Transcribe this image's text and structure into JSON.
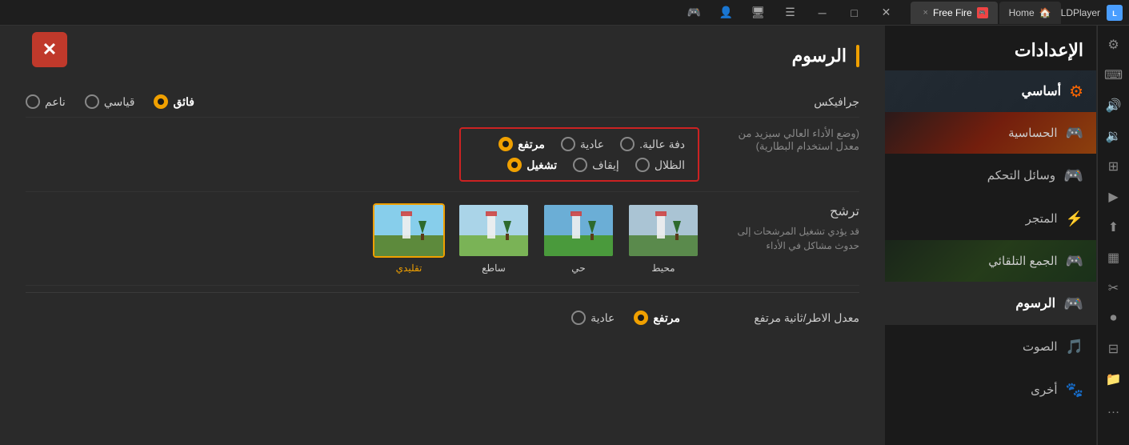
{
  "titlebar": {
    "app_name": "LDPlayer",
    "home_tab": "Home",
    "active_tab": "Free Fire",
    "close_label": "×"
  },
  "nav": {
    "title": "الإعدادات",
    "items": [
      {
        "id": "basic",
        "label": "أساسي",
        "icon": "⚙"
      },
      {
        "id": "sensitivity",
        "label": "الحساسية",
        "icon": "🎮"
      },
      {
        "id": "controls",
        "label": "وسائل التحكم",
        "icon": "🎮"
      },
      {
        "id": "store",
        "label": "المتجر",
        "icon": "🏪"
      },
      {
        "id": "auto",
        "label": "الجمع التلقائي",
        "icon": "🎮"
      },
      {
        "id": "graphics",
        "label": "الرسوم",
        "icon": "🎮",
        "active": true
      },
      {
        "id": "sound",
        "label": "الصوت",
        "icon": "🎵"
      },
      {
        "id": "other",
        "label": "أخرى",
        "icon": "🐾"
      }
    ]
  },
  "content": {
    "section_title": "الرسوم",
    "graphics_label": "جرافيكس",
    "graphics_options": [
      {
        "id": "smooth",
        "label": "ناعم",
        "selected": false
      },
      {
        "id": "standard",
        "label": "قياسي",
        "selected": false
      },
      {
        "id": "ultra",
        "label": "فائق",
        "selected": true
      }
    ],
    "perf_note_1": "(وضع الأداء العالي سيزيد من",
    "perf_note_2": "معدل استخدام البطارية)",
    "perf_options": [
      {
        "id": "high_def",
        "label": "دفة عالية.",
        "selected": false
      },
      {
        "id": "normal",
        "label": "عادية",
        "selected": false
      },
      {
        "id": "high",
        "label": "مرتفع",
        "selected": true
      }
    ],
    "perf_options2": [
      {
        "id": "shadows",
        "label": "الظلال",
        "selected": false
      },
      {
        "id": "stop",
        "label": "إيقاف",
        "selected": false
      },
      {
        "id": "enable",
        "label": "تشغيل",
        "selected": true
      }
    ],
    "filter_label": "ترشح",
    "filter_sublabel": "قد يؤدي تشغيل المرشحات إلى\nحدوث مشاكل في الأداء",
    "filter_options": [
      {
        "id": "classic",
        "label": "تقليدي",
        "selected": true
      },
      {
        "id": "surface",
        "label": "ساطع",
        "selected": false
      },
      {
        "id": "vivid",
        "label": "حي",
        "selected": false
      },
      {
        "id": "env",
        "label": "محيط",
        "selected": false
      }
    ],
    "fps_label": "معدل الاطر/ثانية مرتفع",
    "fps_options": [
      {
        "id": "normal",
        "label": "عادية",
        "selected": false
      },
      {
        "id": "high",
        "label": "مرتفع",
        "selected": true
      }
    ]
  },
  "right_sidebar_icons": [
    "⚙",
    "⌨",
    "🔊",
    "🔉",
    "⊞",
    "▶",
    "⬆",
    "⊞",
    "✂",
    "▶",
    "⊟",
    "📁",
    "…"
  ],
  "close_button": "✕"
}
